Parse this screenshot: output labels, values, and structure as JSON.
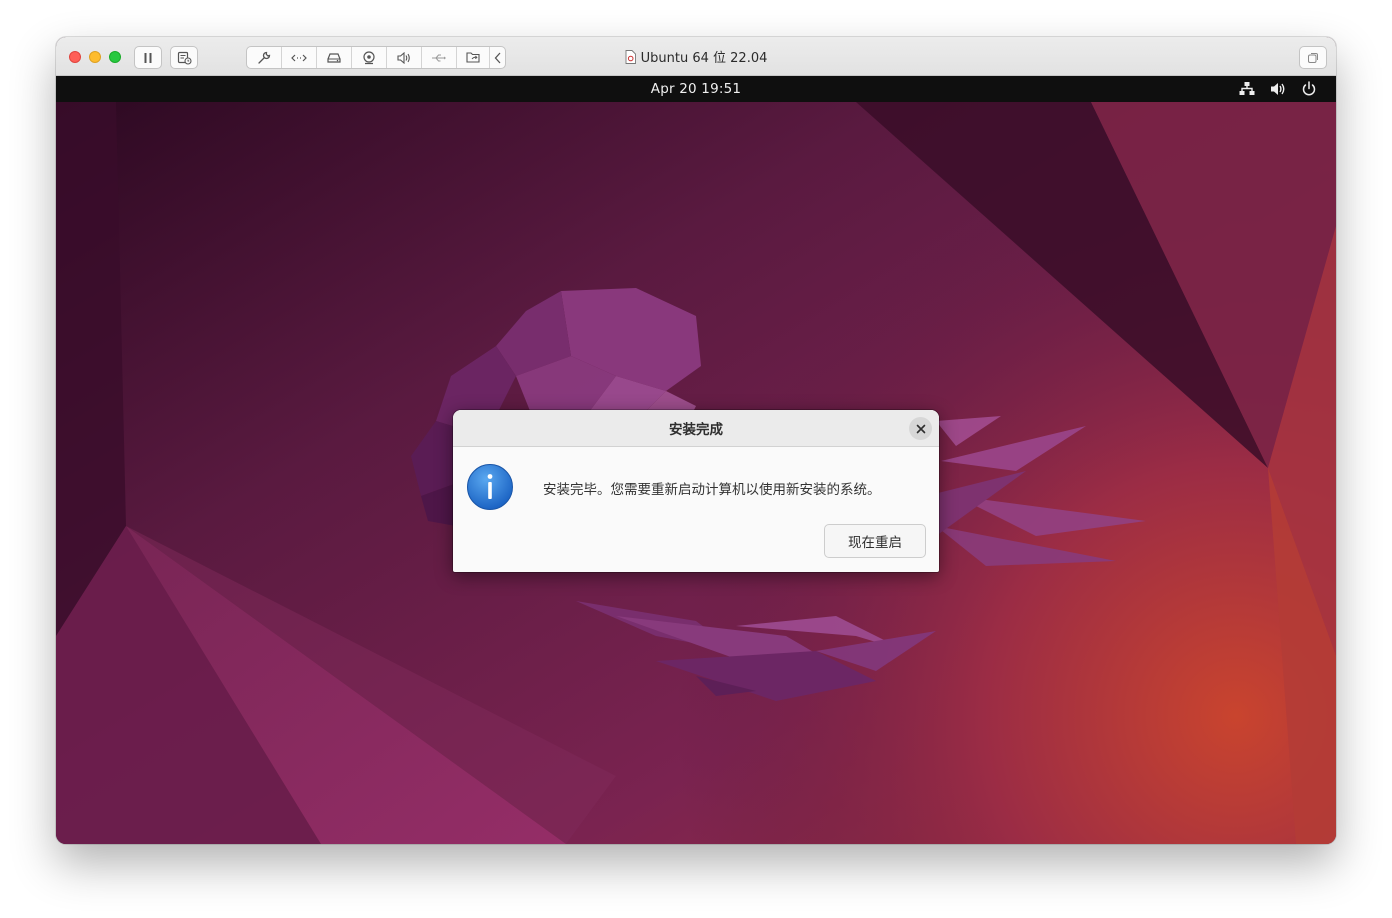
{
  "window": {
    "title": "Ubuntu 64 位 22.04",
    "toolbar_icons": [
      "pause-icon",
      "snapshot-icon",
      "settings-wrench-icon",
      "code-arrows-icon",
      "hard-disk-icon",
      "camera-icon",
      "speaker-icon",
      "usb-icon",
      "shared-folder-icon",
      "chevron-left-icon",
      "fullscreen-icon"
    ]
  },
  "vm": {
    "topbar": {
      "clock": "Apr 20  19:51",
      "tray_icons": [
        "network-icon",
        "volume-icon",
        "power-icon"
      ]
    },
    "dialog": {
      "title": "安装完成",
      "message": "安装完毕。您需要重新启动计算机以使用新安装的系统。",
      "button_label": "现在重启",
      "icon": "info-icon"
    }
  },
  "colors": {
    "wallpaper_dark": "#2c0a22",
    "wallpaper_mid": "#6e1f4a",
    "wallpaper_orange": "#c2412e",
    "info_blue": "#2a7bd6"
  }
}
